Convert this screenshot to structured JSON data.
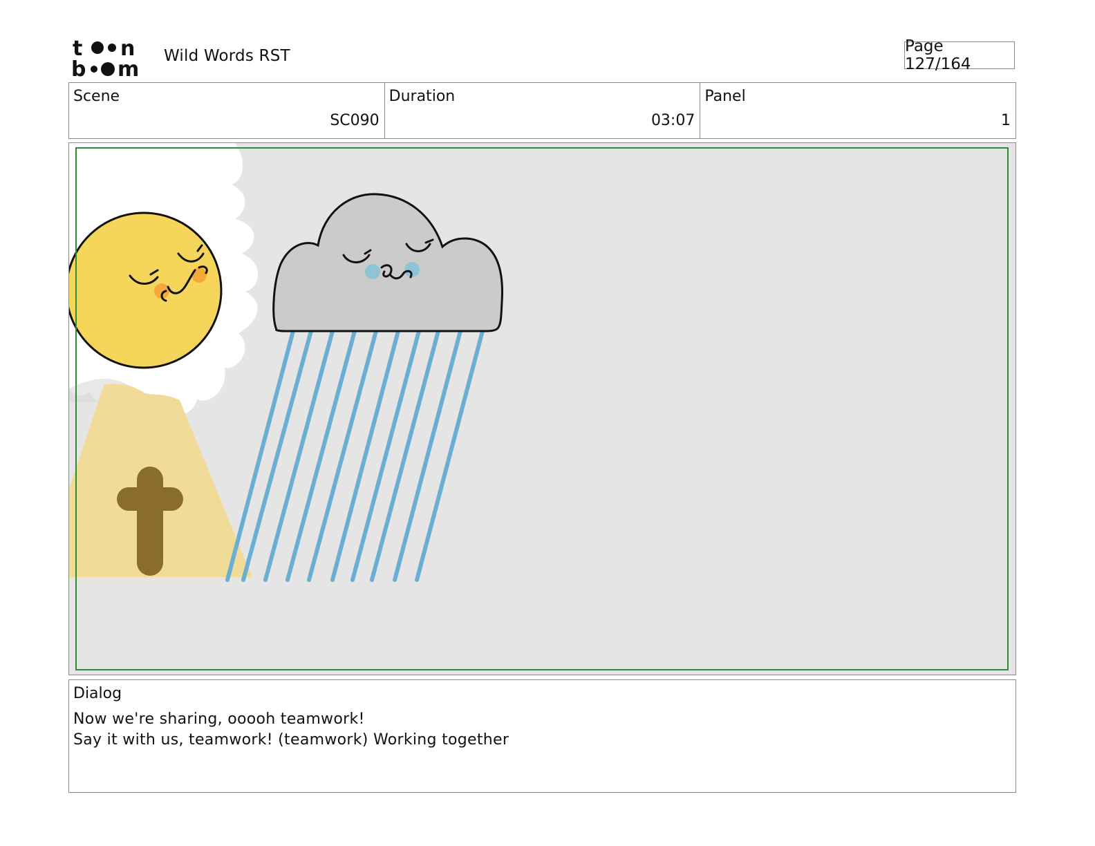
{
  "header": {
    "logo_text": "toonboom",
    "project_title": "Wild Words RST",
    "page_label": "Page 127/164"
  },
  "info": {
    "scene_label": "Scene",
    "scene_value": "SC090",
    "duration_label": "Duration",
    "duration_value": "03:07",
    "panel_label": "Panel",
    "panel_value": "1"
  },
  "panel_image": {
    "elements": [
      "sun-character",
      "rain-cloud-character",
      "rain-streaks",
      "cross-in-light-beam"
    ],
    "colors": {
      "background": "#e5e5e5",
      "safe_frame": "#2e8b2e",
      "sun": "#f5d55a",
      "sun_cheek": "#f4a93a",
      "cloud": "#cbcbcb",
      "cloud_cheek": "#8fc3d6",
      "rain": "#6aaed3",
      "light_beam": "#f0dc98",
      "cross": "#8a6d2e"
    }
  },
  "dialog": {
    "label": "Dialog",
    "lines": [
      "Now we're sharing, ooooh teamwork!",
      "Say it with us, teamwork! (teamwork) Working together"
    ]
  }
}
